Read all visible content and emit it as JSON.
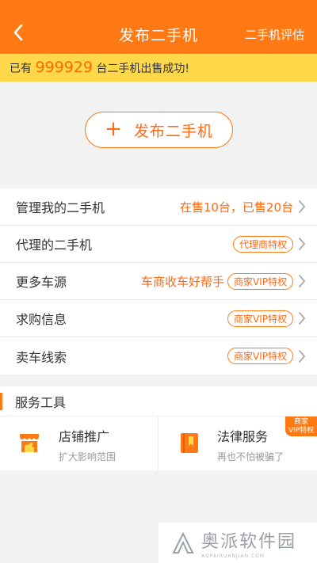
{
  "header": {
    "title": "发布二手机",
    "action": "二手机评估"
  },
  "banner": {
    "prefix": "已有",
    "count": "999929",
    "suffix": "台二手机出售成功!"
  },
  "publish": {
    "plus": "+",
    "label": "发布二手机"
  },
  "rows": [
    {
      "label": "管理我的二手机",
      "status": "在售10台，已售20台",
      "badge": ""
    },
    {
      "label": "代理的二手机",
      "status": "",
      "badge": "代理商特权"
    },
    {
      "label": "更多车源",
      "status": "车商收车好帮手",
      "badge": "商家VIP特权"
    },
    {
      "label": "求购信息",
      "status": "",
      "badge": "商家VIP特权"
    },
    {
      "label": "卖车线索",
      "status": "",
      "badge": "商家VIP特权"
    }
  ],
  "section": {
    "title": "服务工具"
  },
  "tools": [
    {
      "name": "店铺推广",
      "desc": "扩大影响范围",
      "icon": "shop-icon"
    },
    {
      "name": "法律服务",
      "desc": "再也不怕被骗了",
      "icon": "law-book-icon",
      "tag_line1": "商家",
      "tag_line2": "VIP特权"
    }
  ],
  "watermark": {
    "main": "奥派软件园",
    "sub": "AOPAIRUANJIAN.COM"
  },
  "colors": {
    "accent": "#ff7a14",
    "banner": "#ffd84a",
    "highlight": "#ff6a00"
  }
}
